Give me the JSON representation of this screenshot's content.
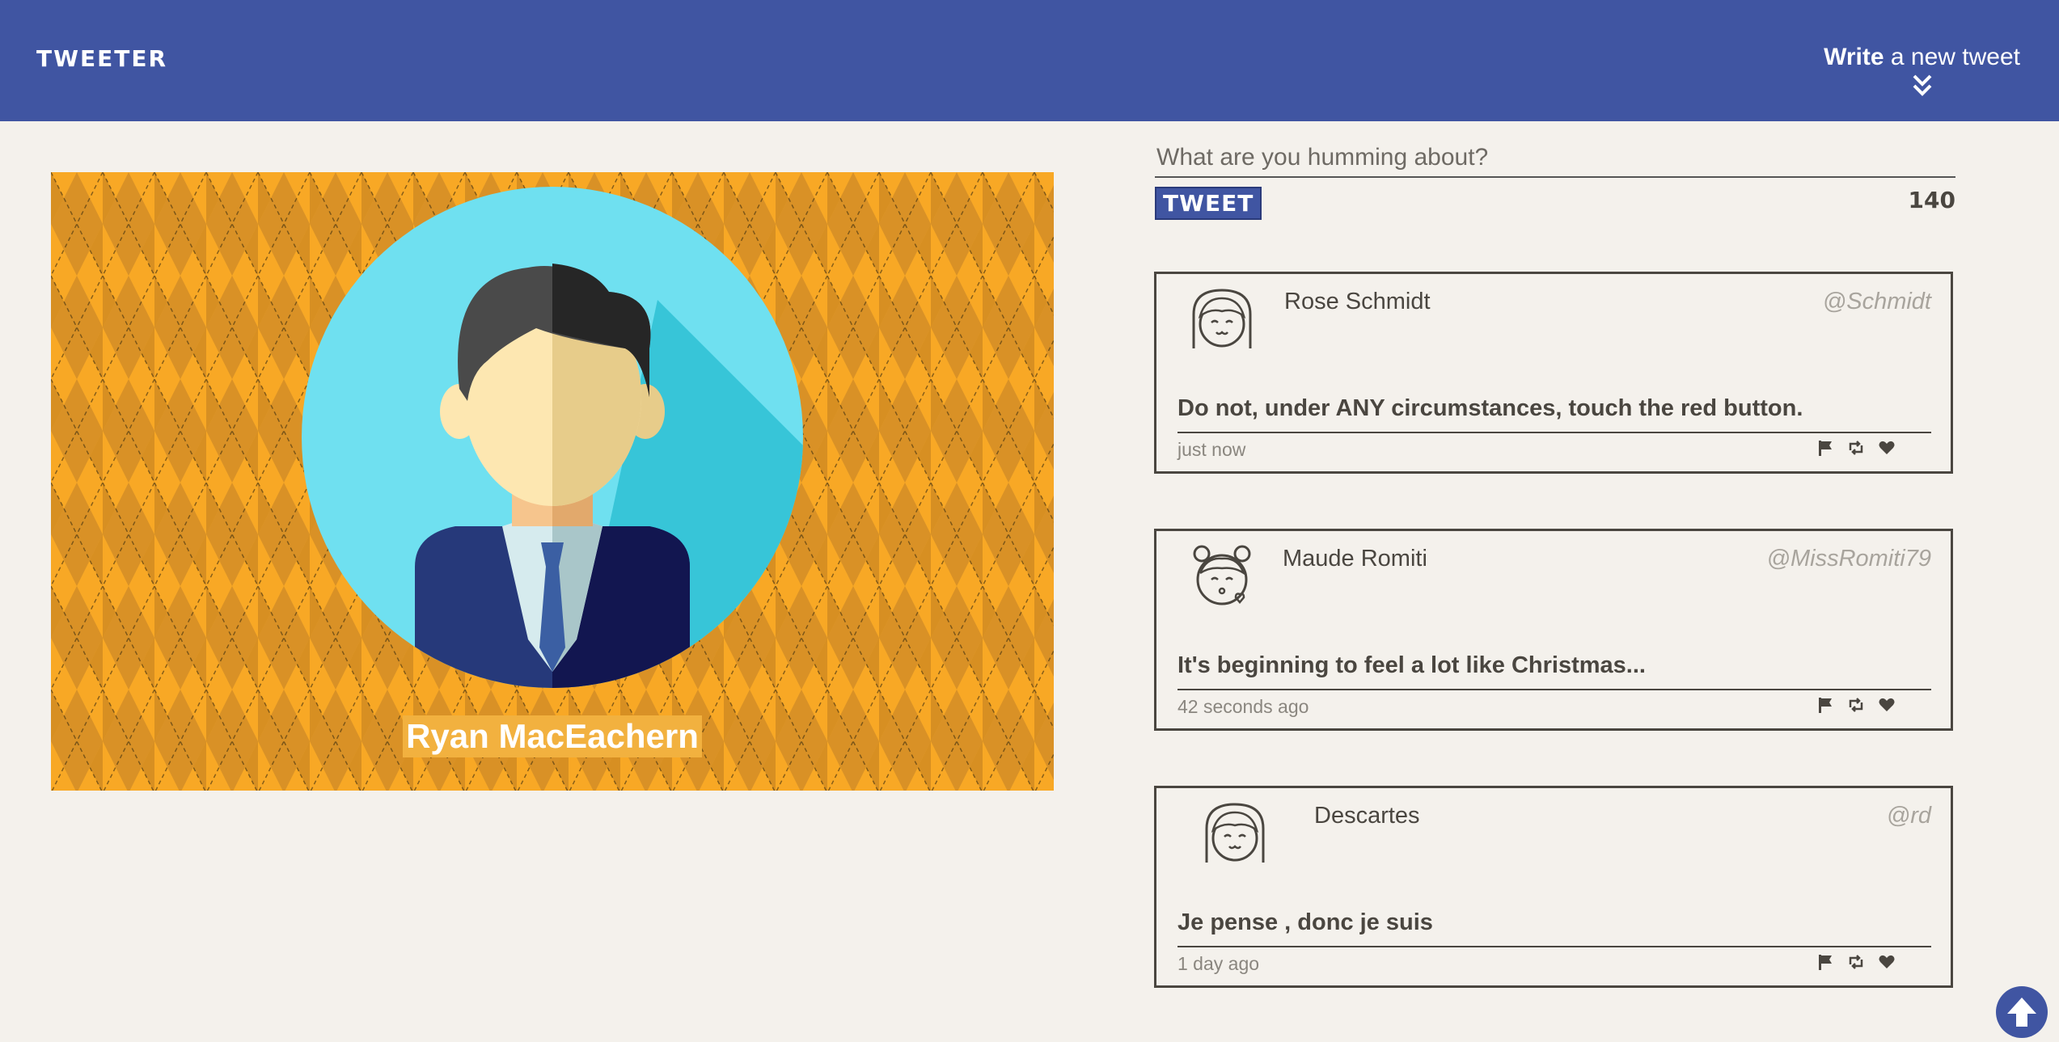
{
  "nav": {
    "brand": "TWEETER",
    "compose_bold": "Write",
    "compose_rest": " a new tweet",
    "chevron_icon": "double-chevron-down-icon",
    "bg_color": "#4055a2"
  },
  "profile": {
    "name": "Ryan MacEachern",
    "pattern": "argyle",
    "pattern_colors": [
      "#f8a825",
      "#d89125",
      "#b9781f"
    ],
    "avatar_bg": "#6fe0f0"
  },
  "composer": {
    "placeholder": "What are you humming about?",
    "submit_label": "TWEET",
    "char_counter": "140"
  },
  "tweets": [
    {
      "name": "Rose Schmidt",
      "handle": "@Schmidt",
      "content": "Do not, under ANY circumstances, touch the red button.",
      "time": "just now",
      "avatar_icon": "girl-bangs-face-icon"
    },
    {
      "name": "Maude Romiti",
      "handle": "@MissRomiti79",
      "content": "It's beginning to feel a lot like Christmas...",
      "time": "42 seconds ago",
      "avatar_icon": "girl-buns-kiss-face-icon"
    },
    {
      "name": "Descartes",
      "handle": "@rd",
      "content": "Je pense , donc je suis",
      "time": "1 day ago",
      "avatar_icon": "girl-bangs-face-icon"
    }
  ],
  "actions": [
    "flag-icon",
    "retweet-icon",
    "heart-icon"
  ],
  "scroll_top_icon": "arrow-up-icon"
}
